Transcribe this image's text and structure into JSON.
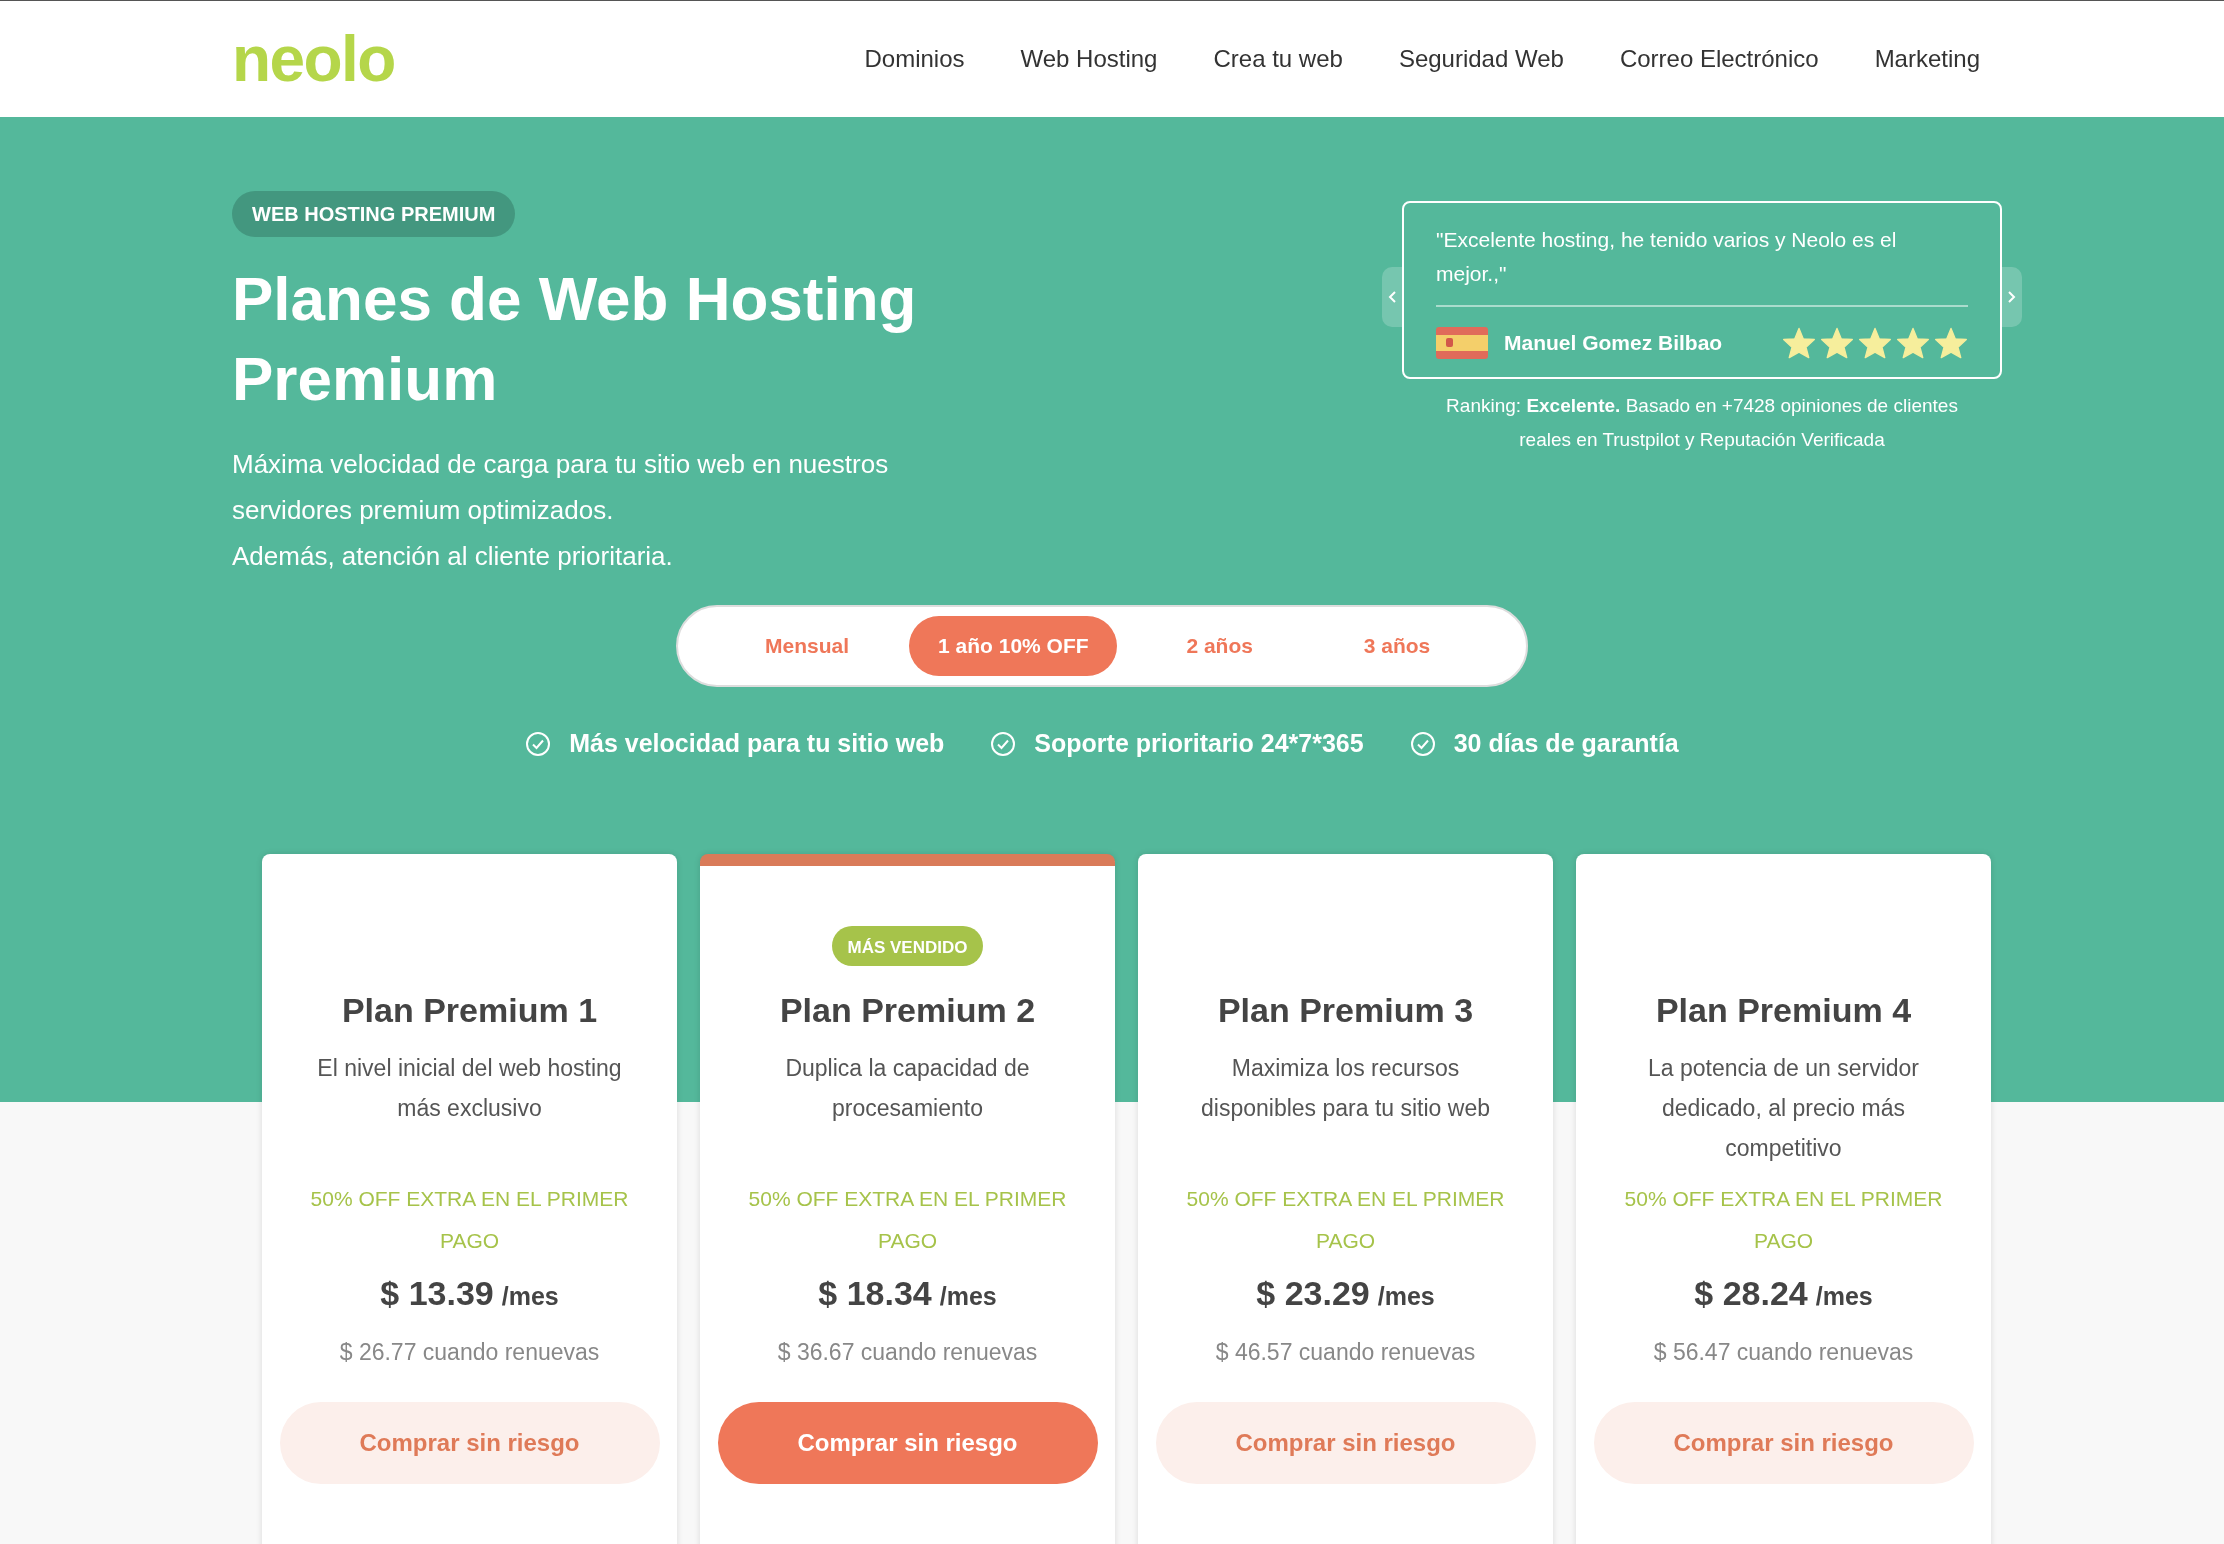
{
  "header": {
    "logo": "neolo",
    "nav": [
      "Dominios",
      "Web Hosting",
      "Crea tu web",
      "Seguridad Web",
      "Correo Electrónico",
      "Marketing"
    ]
  },
  "hero": {
    "badge": "WEB HOSTING PREMIUM",
    "title": "Planes de Web Hosting Premium",
    "paragraphs": [
      "Máxima velocidad de carga para tu sitio web en nuestros servidores premium optimizados.",
      "Además, atención al cliente prioritaria."
    ]
  },
  "testimonial": {
    "quote": "\"Excelente hosting, he tenido varios y Neolo es el mejor.,\"",
    "author": "Manuel Gomez Bilbao",
    "stars": 5,
    "ranking": "Ranking: **Excelente.** Basado en +7428 opiniones de clientes reales en Trustpilot y Reputación Verificada"
  },
  "billing_tabs": [
    {
      "label": "Mensual",
      "selected": false
    },
    {
      "label": "1 año 10% OFF",
      "selected": true
    },
    {
      "label": "2 años",
      "selected": false
    },
    {
      "label": "3 años",
      "selected": false
    }
  ],
  "features": [
    "Más velocidad para tu sitio web",
    "Soporte prioritario 24*7*365",
    "30 días de garantía"
  ],
  "plans": [
    {
      "name": "Plan Premium 1",
      "description": "El nivel inicial del web hosting más exclusivo",
      "featured": false,
      "promo": "50% OFF EXTRA EN EL PRIMER PAGO",
      "price": "$ 13.39",
      "unit": "/mes",
      "renewal": "$ 26.77 cuando renuevas",
      "button": "Comprar sin riesgo"
    },
    {
      "name": "Plan Premium 2",
      "badge": "MÁS VENDIDO",
      "description": "Duplica la capacidad de procesamiento",
      "featured": true,
      "promo": "50% OFF EXTRA EN EL PRIMER PAGO",
      "price": "$ 18.34",
      "unit": "/mes",
      "renewal": "$ 36.67 cuando renuevas",
      "button": "Comprar sin riesgo"
    },
    {
      "name": "Plan Premium 3",
      "description": "Maximiza los recursos disponibles para tu sitio web",
      "featured": false,
      "promo": "50% OFF EXTRA EN EL PRIMER PAGO",
      "price": "$ 23.29",
      "unit": "/mes",
      "renewal": "$ 46.57 cuando renuevas",
      "button": "Comprar sin riesgo"
    },
    {
      "name": "Plan Premium 4",
      "description": "La potencia de un servidor dedicado, al precio más competitivo",
      "featured": false,
      "promo": "50% OFF EXTRA EN EL PRIMER PAGO",
      "price": "$ 28.24",
      "unit": "/mes",
      "renewal": "$ 56.47 cuando renuevas",
      "button": "Comprar sin riesgo"
    }
  ]
}
